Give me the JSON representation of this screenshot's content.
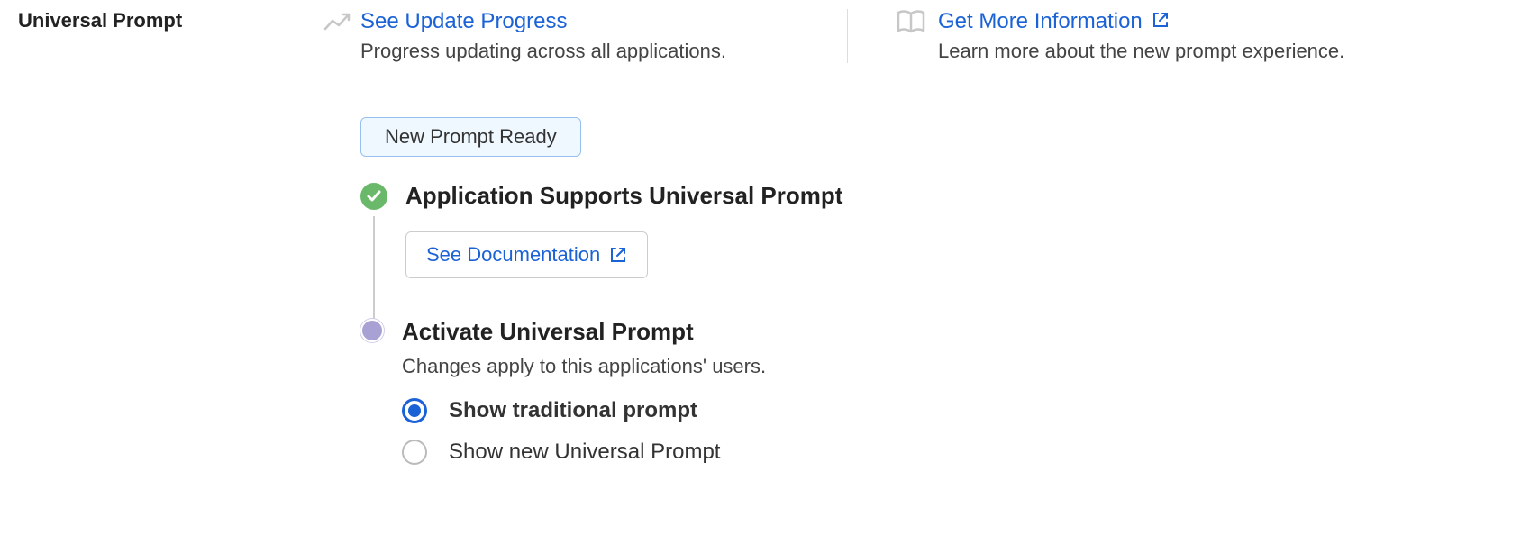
{
  "section_title": "Universal Prompt",
  "update": {
    "link": "See Update Progress",
    "desc": "Progress updating across all applications."
  },
  "info": {
    "link": "Get More Information",
    "desc": "Learn more about the new prompt experience."
  },
  "ready_badge": "New Prompt Ready",
  "step1": {
    "title": "Application Supports Universal Prompt",
    "doc_button": "See Documentation"
  },
  "step2": {
    "title": "Activate Universal Prompt",
    "desc": "Changes apply to this applications' users.",
    "options": {
      "traditional": "Show traditional prompt",
      "universal": "Show new Universal Prompt"
    }
  }
}
